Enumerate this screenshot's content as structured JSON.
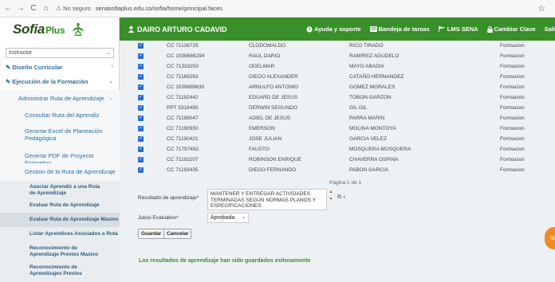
{
  "browser": {
    "back_icon": "←",
    "forward_icon": "→",
    "reload_icon": "C",
    "home_icon": "⌂",
    "insecure_label": "No seguro",
    "url": "senasofiaplus.edu.co/sofia/home/principal.faces",
    "bookmark_icon": "☆"
  },
  "header": {
    "logo_text": "Sofia",
    "logo_plus": "Plus",
    "user_name": "DAIRO ARTURO CADAVID",
    "links": [
      {
        "label": "Ayuda y soporte",
        "icon": "help-icon"
      },
      {
        "label": "Bandeja de tareas",
        "icon": "tray-icon"
      },
      {
        "label": "LMS SENA",
        "icon": "flag-icon"
      },
      {
        "label": "Cambiar Clave",
        "icon": "lock-icon"
      },
      {
        "label": "Sali",
        "icon": ""
      }
    ]
  },
  "sidebar": {
    "role_select": "Instructor",
    "items": [
      {
        "label": "Diseño Curricular"
      },
      {
        "label": "Ejecución de la Formación"
      },
      {
        "label": "Administrar Ruta de Aprendizaje"
      },
      {
        "label": "Consultar Ruta del Aprendiz"
      },
      {
        "label": "Generar Excel de Planeación Pedagógica"
      },
      {
        "label": "Generar PDF de Proyecto Formativo"
      },
      {
        "label": "Gestion de la Ruta de Aprendizaje"
      },
      {
        "label": "Asociar Aprendiz a una Ruta de Aprendizaje"
      },
      {
        "label": "Evaluar Ruta de Aprendizaje"
      },
      {
        "label": "Evaluar Ruta de Aprendizaje Masivo"
      },
      {
        "label": "Listar Aprendices Asociados a Ruta"
      },
      {
        "label": "Reconocimiento de Aprendizaje Previos Masivo"
      },
      {
        "label": "Reconocimiento de Aprendizajes Previos"
      }
    ]
  },
  "table": {
    "rows": [
      {
        "doc": "CC 71138725",
        "name": "CLODOMALDO",
        "last": "RICO TIRADO",
        "state": "Formacion"
      },
      {
        "doc": "CC 1039686294",
        "name": "RAUL DARIO",
        "last": "RAMIREZ AGUDELO",
        "state": "Formacion"
      },
      {
        "doc": "CC 71333250",
        "name": "ODELMAR",
        "last": "MAYO ABADIA",
        "state": "Formacion"
      },
      {
        "doc": "CC 71169263",
        "name": "DIEGO ALEXANDER",
        "last": "CATAÑO HERNANDEZ",
        "state": "Formacion"
      },
      {
        "doc": "CC 1039689635",
        "name": "ARNULFO ANTONIO",
        "last": "GOMEZ MORALES",
        "state": "Formacion"
      },
      {
        "doc": "CC 71192442",
        "name": "EDUARD DE JESUS",
        "last": "TOBON GARZON",
        "state": "Formacion"
      },
      {
        "doc": "PPT 5316495",
        "name": "DERWIN SEGUNDO",
        "last": "GIL GIL",
        "state": "Formacion"
      },
      {
        "doc": "CC 71198047",
        "name": "ADIEL DE JESUS",
        "last": "PARRA MARIN",
        "state": "Formacion"
      },
      {
        "doc": "CC 71190550",
        "name": "EMERSON",
        "last": "MOLINA MONTOYA",
        "state": "Formacion"
      },
      {
        "doc": "CC 71190421",
        "name": "JOSE JULIAN",
        "last": "GARCIA VELEZ",
        "state": "Formacion"
      },
      {
        "doc": "CC 71797492",
        "name": "FAUSTO",
        "last": "MOSQUERA MOSQUERA",
        "state": "Formacion"
      },
      {
        "doc": "CC 71192207",
        "name": "ROBINSON ENRIQUE",
        "last": "CHAVERRA OSPINA",
        "state": "Formacion"
      },
      {
        "doc": "CC 71193435",
        "name": "DIEGO FERNANDO",
        "last": "PABON GARCIA",
        "state": "Formacion"
      }
    ],
    "pager": "Página 1 de 1"
  },
  "form": {
    "result_label": "Resultado de aprendizaje*",
    "result_value": "MANTENER Y ENTREGAR ACTIVIDADES TERMINADAS SEGÚN NORMAS PLANOS Y ESPECIFICACIONES",
    "judgement_label": "Juicio Evaluativo*",
    "judgement_value": "Aprobada",
    "save_label": "Guardar",
    "cancel_label": "Cancelar",
    "success_message": "Los resultados de aprendizaje han sido guardados exitosamente"
  },
  "colors": {
    "header_green": "#3a8f2a",
    "link_blue": "#2d6f9e",
    "checkbox_blue": "#2a6ad0",
    "success_green": "#3a8f2a",
    "chat_orange": "#f08a24"
  }
}
